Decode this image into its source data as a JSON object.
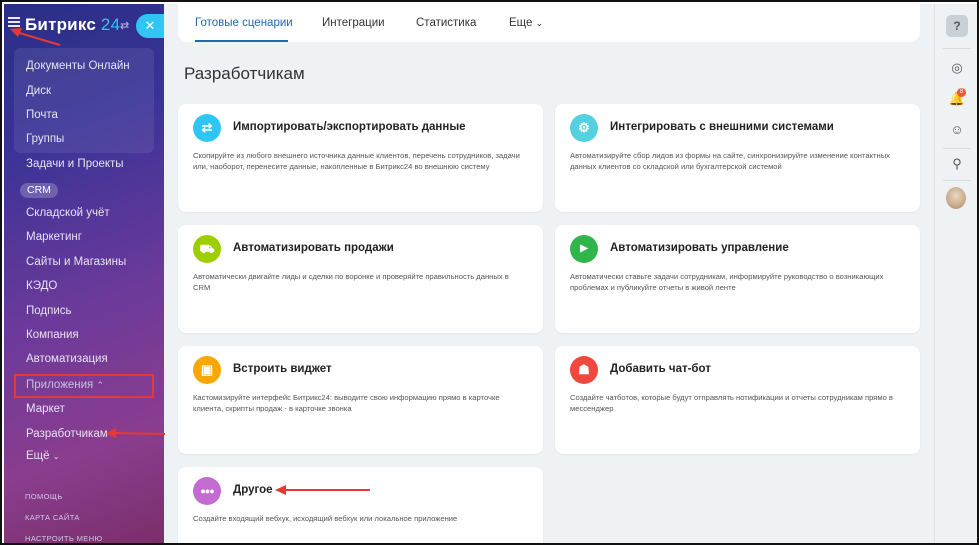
{
  "sidebar": {
    "logo_main": "Битрикс",
    "logo_num": "24",
    "items": [
      {
        "label": "Документы Онлайн"
      },
      {
        "label": "Диск"
      },
      {
        "label": "Почта"
      },
      {
        "label": "Группы"
      },
      {
        "label": "Задачи и Проекты"
      },
      {
        "label": "CRM"
      },
      {
        "label": "Складской учёт"
      },
      {
        "label": "Маркетинг"
      },
      {
        "label": "Сайты и Магазины"
      },
      {
        "label": "КЭДО"
      },
      {
        "label": "Подпись"
      },
      {
        "label": "Компания"
      },
      {
        "label": "Автоматизация"
      },
      {
        "label": "Приложения"
      },
      {
        "label": "Маркет"
      },
      {
        "label": "Разработчикам"
      },
      {
        "label": "Ещё"
      }
    ],
    "footer_links": [
      "ПОМОЩЬ",
      "КАРТА САЙТА",
      "НАСТРОИТЬ МЕНЮ"
    ]
  },
  "tabs": [
    {
      "label": "Готовые сценарии",
      "active": true
    },
    {
      "label": "Интеграции"
    },
    {
      "label": "Статистика"
    },
    {
      "label": "Еще"
    }
  ],
  "page_title": "Разработчикам",
  "cards": [
    {
      "title": "Импортировать/экспортировать данные",
      "desc": "Скопируйте из любого внешнего источника данные клиентов, перечень сотрудников, задачи или, наоборот, перенесите данные, накопленные в Битрикс24 во внешнюю систему",
      "icon": "arrows-swap-icon",
      "color": "#2fc6f6",
      "glyph": "⇄"
    },
    {
      "title": "Интегрировать с внешними системами",
      "desc": "Автоматизируйте сбор лидов из формы на сайте, синхронизируйте изменение контактных данных клиентов со складской или бухгалтерской системой",
      "icon": "gears-icon",
      "color": "#55d0e0",
      "glyph": "⚙"
    },
    {
      "title": "Автоматизировать продажи",
      "desc": "Автоматически двигайте лиды и сделки по воронке и проверяйте правильность данных в CRM",
      "icon": "cart-icon",
      "color": "#9dcf00",
      "glyph": "🛒"
    },
    {
      "title": "Автоматизировать управление",
      "desc": "Автоматически ставьте задачи сотрудникам, информируйте руководство о возникающих проблемах и публикуйте отчеты в живой ленте",
      "icon": "play-icon",
      "color": "#2fb54a",
      "glyph": "▶"
    },
    {
      "title": "Встроить виджет",
      "desc": "Кастомизируйте интерфейс Битрикс24: выводите свою информацию прямо в карточке клиента, скрипты продаж - в карточке звонка",
      "icon": "widget-icon",
      "color": "#f7a700",
      "glyph": "▣"
    },
    {
      "title": "Добавить чат-бот",
      "desc": "Создайте чатботов, которые будут отправлять нотификации и отчеты сотрудникам прямо в мессенджер",
      "icon": "android-icon",
      "color": "#f0483e",
      "glyph": "🤖"
    },
    {
      "title": "Другое",
      "desc": "Создайте входящий вебхук, исходящий вебхук или локальное приложение",
      "icon": "more-dots-icon",
      "color": "#c26ccf",
      "glyph": "•••"
    }
  ],
  "rail": {
    "help": "?",
    "bell_count": "8"
  }
}
